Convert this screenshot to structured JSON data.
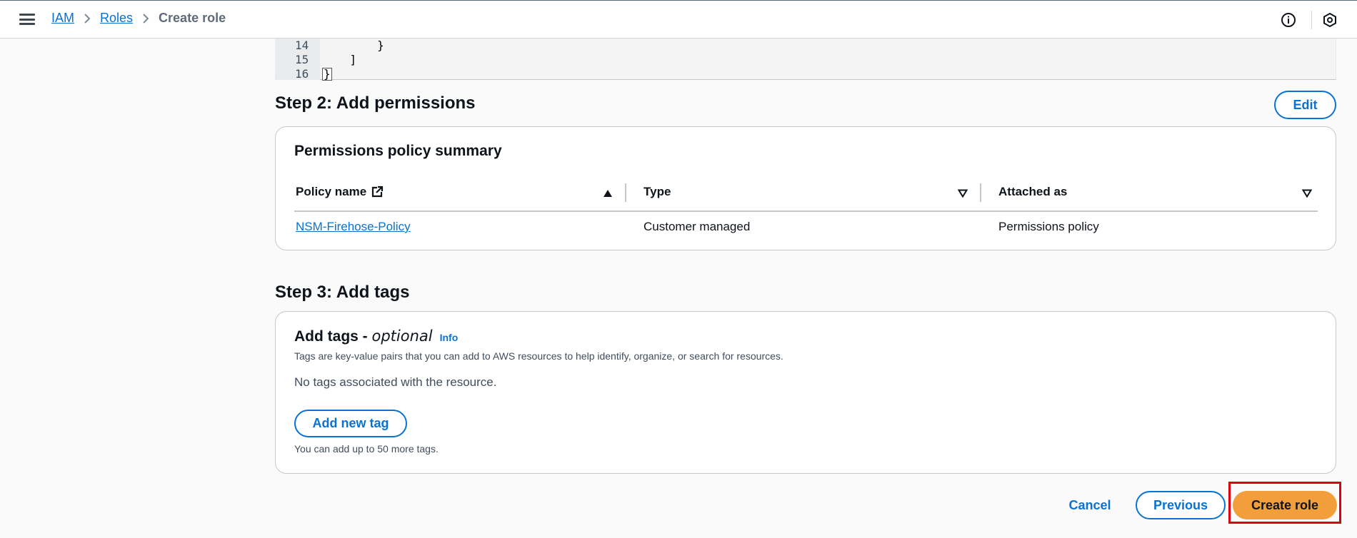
{
  "header": {
    "breadcrumb": [
      {
        "label": "IAM",
        "link": true
      },
      {
        "label": "Roles",
        "link": true
      },
      {
        "label": "Create role",
        "link": false
      }
    ],
    "icons": [
      "menu-icon",
      "info-icon",
      "settings-icon"
    ]
  },
  "code": {
    "lines": [
      {
        "n": "14",
        "text": "        }"
      },
      {
        "n": "15",
        "text": "    ]"
      },
      {
        "n": "16",
        "text": "}"
      }
    ]
  },
  "step2": {
    "title": "Step 2: Add permissions",
    "edit_label": "Edit",
    "summary_title": "Permissions policy summary",
    "columns": [
      "Policy name",
      "Type",
      "Attached as"
    ],
    "rows": [
      {
        "policy_name": "NSM-Firehose-Policy",
        "type": "Customer managed",
        "attached_as": "Permissions policy"
      }
    ]
  },
  "step3": {
    "title": "Step 3: Add tags",
    "card_title": "Add tags - ",
    "card_title_optional": "optional",
    "info_label": "Info",
    "description": "Tags are key-value pairs that you can add to AWS resources to help identify, organize, or search for resources.",
    "empty_text": "No tags associated with the resource.",
    "add_tag_label": "Add new tag",
    "limit_text": "You can add up to 50 more tags."
  },
  "footer": {
    "cancel_label": "Cancel",
    "previous_label": "Previous",
    "create_label": "Create role"
  },
  "colors": {
    "link": "#0972d3",
    "primary_button": "#f29f3b",
    "highlight": "#e0000f"
  }
}
